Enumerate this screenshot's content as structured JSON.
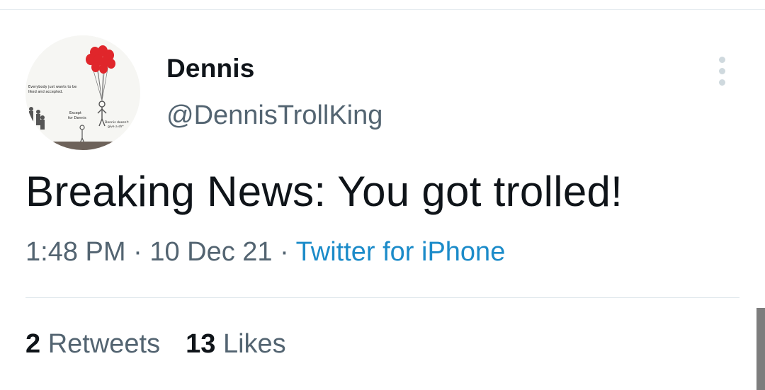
{
  "tweet": {
    "author": {
      "display_name": "Dennis",
      "handle": "@DennisTrollKing",
      "avatar": {
        "text_top_line1": "Everybody just wants to be",
        "text_top_line2": "liked and accepted.",
        "text_except": "Except",
        "text_for_dennis": "for Dennis",
        "text_dennis_doesnt": "Dennis doesn't",
        "text_give": "give a sh*"
      }
    },
    "text": "Breaking News: You got trolled!",
    "time": "1:48 PM",
    "separator": "·",
    "date": "10 Dec 21",
    "source": "Twitter for iPhone",
    "retweets": {
      "count": "2",
      "label": "Retweets"
    },
    "likes": {
      "count": "13",
      "label": "Likes"
    }
  },
  "icons": {
    "more": "more-vertical-icon"
  },
  "colors": {
    "text_primary": "#0f1419",
    "text_secondary": "#536471",
    "link": "#1b8bc9",
    "divider": "#e1e8ed",
    "balloon": "#e0262b"
  }
}
